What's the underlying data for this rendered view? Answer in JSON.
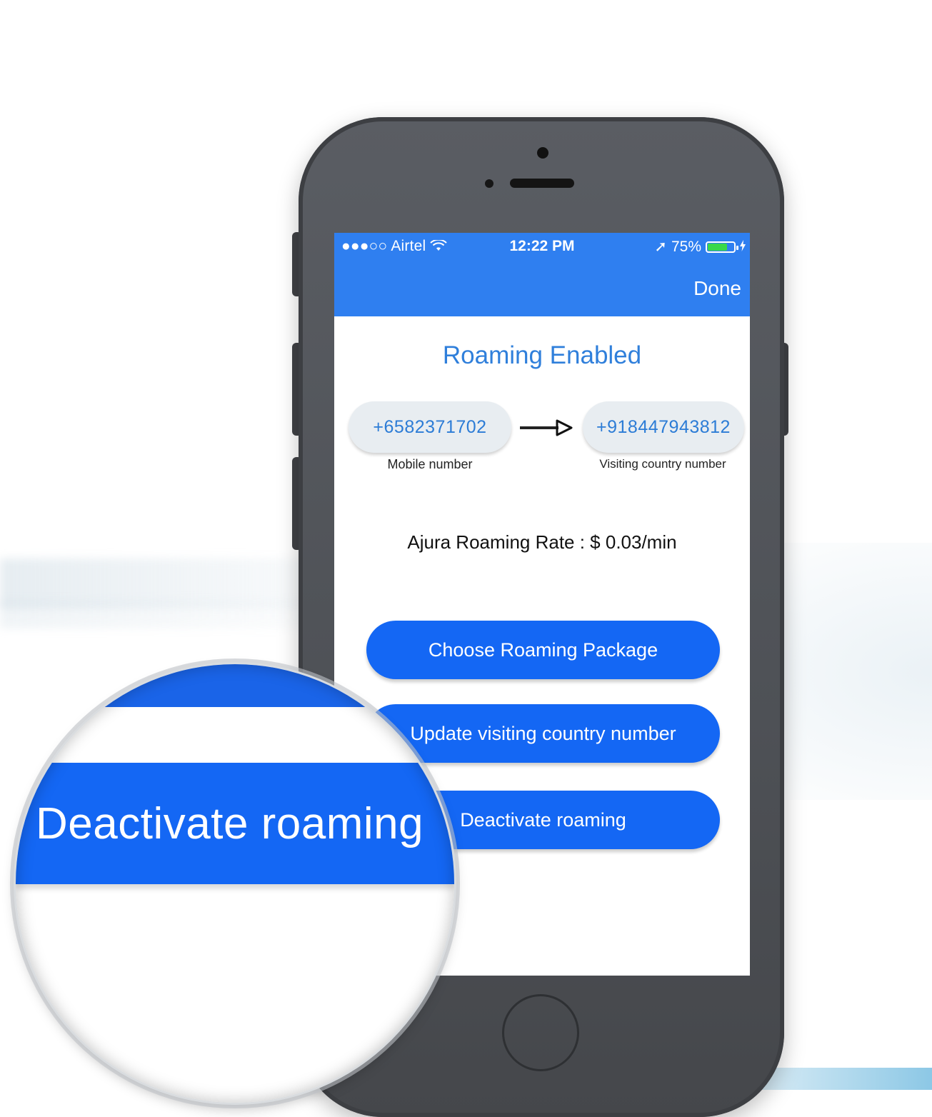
{
  "status_bar": {
    "signal": "●●●○○",
    "carrier": "Airtel",
    "wifi_icon": "wifi-icon",
    "time": "12:22 PM",
    "location_icon": "➚",
    "battery": "75%",
    "battery_level": 0.75,
    "battery_color": "#39d84a"
  },
  "nav": {
    "done_label": "Done",
    "color": "#2f7ff0"
  },
  "main": {
    "title": "Roaming Enabled",
    "mobile_number": "+6582371702",
    "mobile_label": "Mobile number",
    "visiting_number": "+918447943812",
    "visiting_label": "Visiting country number",
    "rate_text": "Ajura Roaming Rate : $ 0.03/min"
  },
  "actions": {
    "choose_package": "Choose Roaming Package",
    "update_number": "Update visiting country number",
    "deactivate": "Deactivate roaming",
    "button_color": "#1467f4"
  },
  "magnifier": {
    "text": "Deactivate roaming"
  }
}
